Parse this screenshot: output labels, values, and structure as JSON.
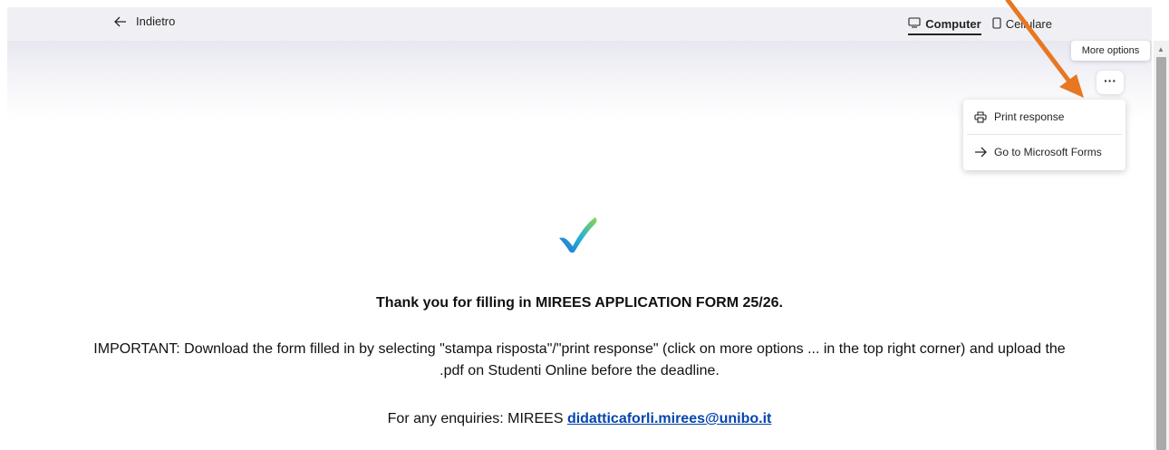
{
  "nav": {
    "back_label": "Indietro",
    "view_options": [
      {
        "label": "Computer",
        "icon": "monitor-icon",
        "selected": true
      },
      {
        "label": "Cellulare",
        "icon": "phone-icon",
        "selected": false
      }
    ]
  },
  "more_options": {
    "tooltip": "More options",
    "button_glyph": "···",
    "menu": [
      {
        "label": "Print response",
        "icon": "printer-icon"
      },
      {
        "label": "Go to Microsoft Forms",
        "icon": "arrow-right-icon"
      }
    ]
  },
  "confirmation": {
    "icon": "checkmark-icon",
    "title": "Thank you for filling in MIREES APPLICATION FORM 25/26.",
    "important_line1": "IMPORTANT: Download the form filled in by selecting \"stampa risposta\"/\"print response\" (click on more options ... in the top right corner) and upload the",
    "important_line2": ".pdf on Studenti Online before the deadline.",
    "enquiries_prefix": "For any enquiries: MIREES ",
    "enquiries_email": "didatticaforli.mirees@unibo.it"
  },
  "colors": {
    "annotation_arrow": "#e87722",
    "link": "#0645ad",
    "topbar": "#f0f0f4"
  }
}
